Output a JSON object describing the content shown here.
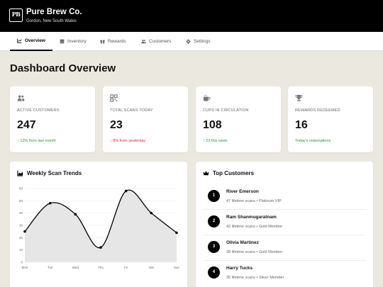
{
  "header": {
    "brand": "Pure Brew Co.",
    "logo_text": "PB",
    "location": "Gordon, New South Wales"
  },
  "nav": {
    "tabs": [
      {
        "label": "Overview",
        "icon": "chart-icon",
        "active": true
      },
      {
        "label": "Inventory",
        "icon": "box-icon"
      },
      {
        "label": "Rewards",
        "icon": "gift-icon"
      },
      {
        "label": "Customers",
        "icon": "users-icon"
      },
      {
        "label": "Settings",
        "icon": "gear-icon"
      }
    ]
  },
  "page_title": "Dashboard Overview",
  "stats": [
    {
      "icon": "users-icon",
      "label": "ACTIVE CUSTOMERS",
      "value": "247",
      "trend": "12% from last month",
      "trend_dir": "up"
    },
    {
      "icon": "qr-code-icon",
      "label": "TOTAL SCANS TODAY",
      "value": "23",
      "trend": "8% from yesterday",
      "trend_dir": "down"
    },
    {
      "icon": "coffee-cup-icon",
      "label": "CUPS IN CIRCULATION",
      "value": "108",
      "trend": "23 this week",
      "trend_dir": "up"
    },
    {
      "icon": "trophy-icon",
      "label": "REWARDS REDEEMED",
      "value": "16",
      "trend": "Today's redemptions",
      "trend_dir": "none"
    }
  ],
  "weekly_panel": {
    "title": "Weekly Scan Trends"
  },
  "chart_data": {
    "type": "area",
    "categories": [
      "Mon",
      "Tue",
      "Wed",
      "Thu",
      "Fri",
      "Sat",
      "Sun"
    ],
    "values": [
      25,
      48,
      39,
      12,
      58,
      40,
      24
    ],
    "ylim": [
      0,
      60
    ],
    "yticks": [
      0,
      10,
      20,
      30,
      40,
      50,
      60
    ],
    "grid": true,
    "line_color": "#000000",
    "fill_color": "#e6e6e6"
  },
  "top_panel": {
    "title": "Top Customers"
  },
  "customers": [
    {
      "rank": "1",
      "name": "River Emerson",
      "meta": "47 lifetime scans • Platinum VIP"
    },
    {
      "rank": "2",
      "name": "Ram Shanmugaratnam",
      "meta": "42 lifetime scans • Gold Member"
    },
    {
      "rank": "3",
      "name": "Olivia Martinez",
      "meta": "38 lifetime scans • Gold Member"
    },
    {
      "rank": "4",
      "name": "Harry Tucks",
      "meta": "35 lifetime scans • Silver Member"
    }
  ],
  "colors": {
    "up": "#1f9a3f",
    "down": "#d42c2c",
    "header_bg": "#000000",
    "page_bg": "#ebe8e0"
  }
}
